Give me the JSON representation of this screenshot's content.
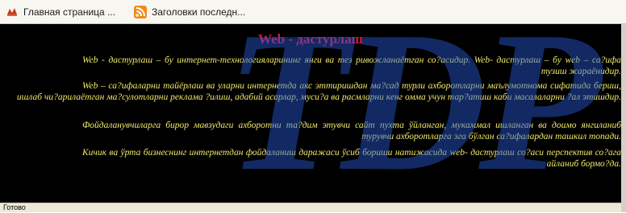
{
  "favorites": [
    {
      "label": "Главная страница ...",
      "icon": "ie-page-icon"
    },
    {
      "label": "Заголовки последн...",
      "icon": "rss-feed-icon"
    }
  ],
  "page": {
    "title": "Web - дастурлаш",
    "paragraphs": [
      "Web - дастурлаш – бу интернет-технологияларининг янги ва тез ривожланаётган со?асидир. Web- дастурлаш – бу web – са?ифа тузиш жараёнидир.",
      "Web – са?ифаларни тайёрлаш ва уларни интернетда акс эттиришдан ма?сад турли ахборотларни маълумотнома сифатида бериш, ишлаб чи?арилаётган ма?сулотларни реклама ?илиш, адабий асарлар, муси?а ва расмларни кенг омма учун тар?атиш каби масалаларни ?ал этишдир.",
      "Фойдаланувчиларга бирор мавзудаги ахборотни та?дим этувчи сайт пухта ўйланган, мукаммал ишланган ва доимо янгиланиб турувчи ахборотларга эга бўлган са?ифалардан ташкил топади.",
      "Кичик ва ўрта бизнеснинг интернетдан фойдаланиш даражаси ўсиб бориши натижасида web- дастурлаш со?аси перспектив со?ага айланиб бормо?да."
    ],
    "background_color": "#000000",
    "title_color": "#dc143c",
    "text_color": "#f2e96a"
  },
  "watermark_text": "TDP",
  "status": {
    "text": "Готово"
  }
}
